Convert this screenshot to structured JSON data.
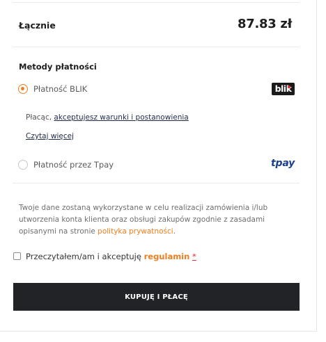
{
  "summary": {
    "total_label": "Łącznie",
    "total_value": "87.83 zł"
  },
  "payment": {
    "title": "Metody płatności",
    "methods": [
      {
        "label": "Płatność BLIK",
        "selected": true,
        "logo_text": "blik"
      },
      {
        "label": "Płatność przez Tpay",
        "selected": false,
        "logo_text": "tpay"
      }
    ],
    "terms_prefix": "Płacąc,",
    "terms_link": "akceptujesz warunki i postanowienia",
    "read_more": "Czytaj więcej"
  },
  "privacy": {
    "text_before": "Twoje dane zostaną wykorzystane w celu realizacji zamówienia i/lub utworzenia konta klienta oraz obsługi zakupów zgodnie z zasadami opisanymi na stronie",
    "link": "polityka prywatności",
    "text_after": "."
  },
  "consent": {
    "text": "Przeczytałem/am i akceptuję",
    "link": "regulamin",
    "required_mark": "*",
    "checked": false
  },
  "buy_button": "KUPUJĘ I PŁACĘ",
  "colors": {
    "accent": "#f07e1f",
    "button_bg": "#222327",
    "tpay_blue": "#1b3e8f",
    "blik_bg": "#1a1a1a"
  }
}
